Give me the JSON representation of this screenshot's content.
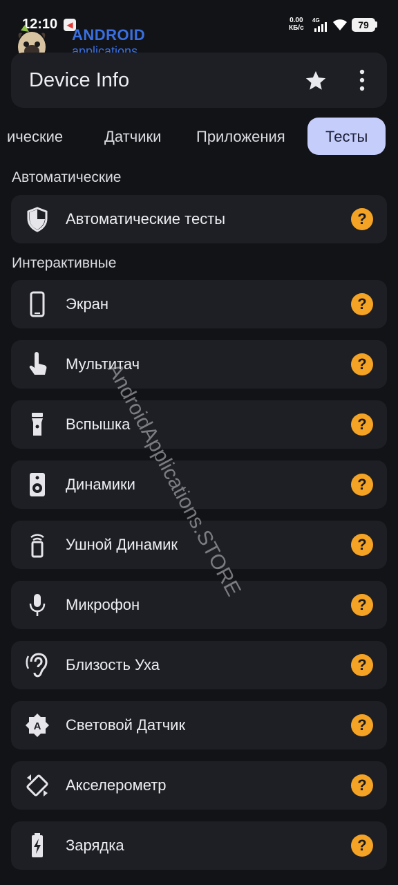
{
  "status": {
    "time": "12:10",
    "speed_top": "0.00",
    "speed_bottom": "КБ/с",
    "network": "4G",
    "battery": "79"
  },
  "watermark": {
    "brand_line1": "ANDROID",
    "brand_line2": "applications",
    "diagonal": "AndroidApplications.STORE"
  },
  "appbar": {
    "title": "Device Info",
    "icons": [
      "star-icon",
      "more-vert-icon"
    ]
  },
  "tabs": [
    {
      "label": "ические"
    },
    {
      "label": "Датчики"
    },
    {
      "label": "Приложения"
    },
    {
      "label": "Тесты",
      "active": true
    }
  ],
  "sections": {
    "auto": {
      "title": "Автоматические",
      "items": [
        {
          "label": "Автоматические тесты",
          "icon": "shield-icon"
        }
      ]
    },
    "interactive": {
      "title": "Интерактивные",
      "items": [
        {
          "label": "Экран",
          "icon": "phone-icon"
        },
        {
          "label": "Мультитач",
          "icon": "touch-icon"
        },
        {
          "label": "Вспышка",
          "icon": "flashlight-icon"
        },
        {
          "label": "Динамики",
          "icon": "speaker-icon"
        },
        {
          "label": "Ушной Динамик",
          "icon": "earpiece-icon"
        },
        {
          "label": "Микрофон",
          "icon": "microphone-icon"
        },
        {
          "label": "Близость Уха",
          "icon": "ear-icon"
        },
        {
          "label": "Световой Датчик",
          "icon": "light-sensor-icon"
        },
        {
          "label": "Акселерометр",
          "icon": "rotate-icon"
        },
        {
          "label": "Зарядка",
          "icon": "battery-charging-icon"
        }
      ]
    }
  },
  "help_glyph": "?",
  "colors": {
    "background": "#121317",
    "card": "#1e1f24",
    "tab_active": "#c5cdfb",
    "help": "#f4a324",
    "brand": "#3a6fe0"
  }
}
